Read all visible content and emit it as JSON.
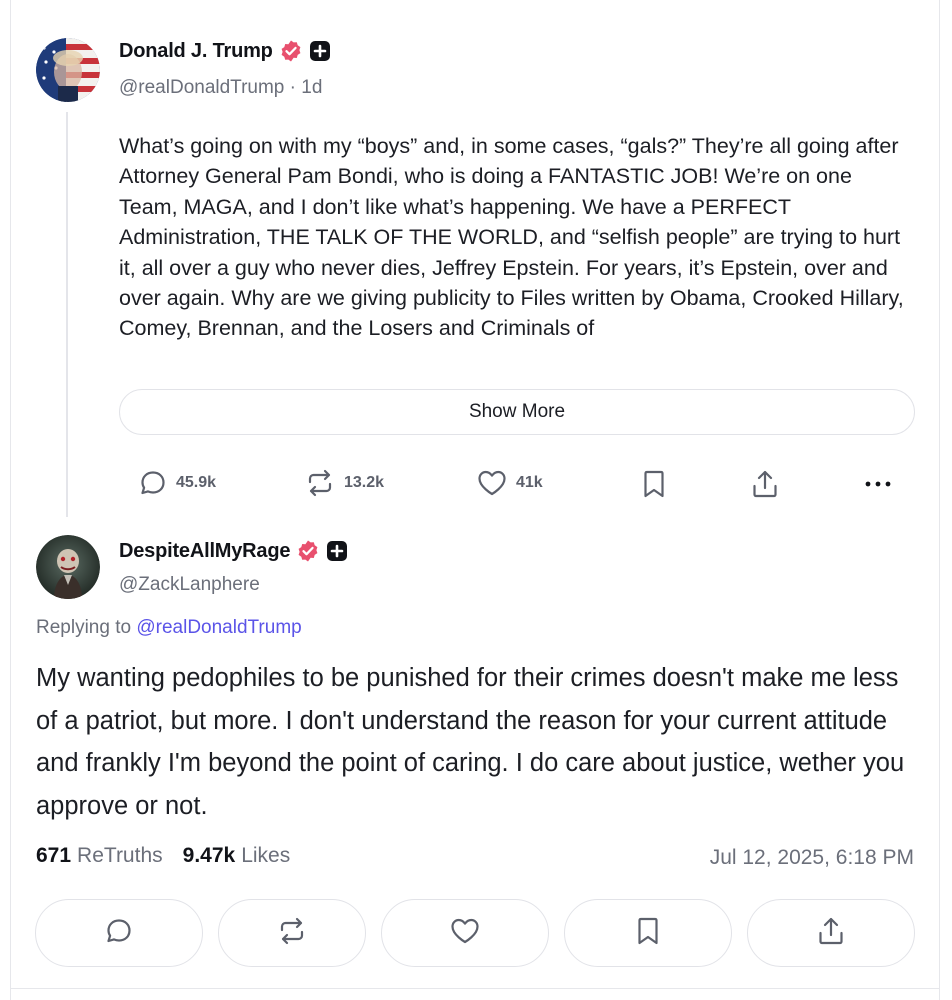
{
  "parent_post": {
    "display_name": "Donald J. Trump",
    "handle": "@realDonaldTrump",
    "age": "· 1d",
    "body": "What’s going on with my “boys” and, in some cases, “gals?” They’re all going after Attorney General Pam Bondi, who is doing a FANTASTIC JOB! We’re on one Team, MAGA, and I don’t like what’s happening. We have a PERFECT Administration, THE TALK OF THE WORLD, and “selfish people” are trying to hurt it, all over a guy who never dies, Jeffrey Epstein. For years, it’s Epstein, over and over again. Why are we giving publicity to Files written by Obama, Crooked Hillary, Comey, Brennan, and the Losers and Criminals of",
    "show_more_label": "Show More",
    "actions": {
      "replies": "45.9k",
      "retruths": "13.2k",
      "likes": "41k"
    },
    "icons": [
      "reply-icon",
      "retruth-icon",
      "like-icon",
      "bookmark-icon",
      "share-icon",
      "more-icon"
    ]
  },
  "reply_post": {
    "display_name": "DespiteAllMyRage",
    "handle": "@ZackLanphere",
    "replying_prefix": "Replying to",
    "replying_to": "@realDonaldTrump",
    "body": "My wanting pedophiles to be punished for their crimes doesn't make me less of a patriot, but more.  I don't understand the reason for your current attitude and frankly I'm beyond the point of caring. I do care about justice, wether you approve or not.",
    "retruths_count": "671",
    "retruths_label": "ReTruths",
    "likes_count": "9.47k",
    "likes_label": "Likes",
    "timestamp": "Jul 12, 2025, 6:18 PM",
    "icons": [
      "reply-icon",
      "retruth-icon",
      "like-icon",
      "bookmark-icon",
      "share-icon"
    ]
  },
  "colors": {
    "verified_badge": "#e8506e",
    "mention": "#5b54e8",
    "muted_text": "#6b6f7a",
    "border": "#e2e3e8"
  }
}
